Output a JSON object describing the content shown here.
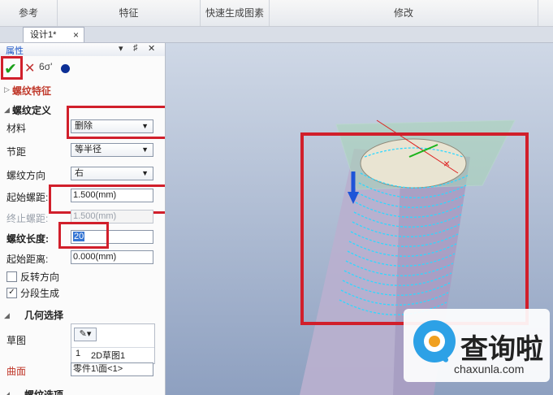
{
  "ribbon": {
    "groups": [
      "参考",
      "特征",
      "快速生成图素",
      "修改"
    ]
  },
  "document_tab": {
    "title": "设计1*"
  },
  "panel": {
    "title": "属性",
    "header_controls": [
      "▾",
      "♯",
      "✕"
    ],
    "toolbar": {
      "ok": "✔",
      "cancel": "✕",
      "preview": "6σ'"
    },
    "section_feature": "螺纹特征",
    "section_definition": "螺纹定义",
    "material": {
      "label": "材料",
      "value": "删除"
    },
    "pitch": {
      "label": "节距",
      "value": "等半径"
    },
    "direction": {
      "label": "螺纹方向",
      "value": "右"
    },
    "start_pitch": {
      "label": "起始螺距:",
      "value": "1.500(mm)"
    },
    "end_pitch": {
      "label": "终止螺距:",
      "value": "1.500(mm)"
    },
    "thread_length": {
      "label": "螺纹长度:",
      "value": "20"
    },
    "start_distance": {
      "label": "起始距离:",
      "value": "0.000(mm)"
    },
    "reverse": {
      "label": "反转方向",
      "checked": false
    },
    "segmented": {
      "label": "分段生成",
      "checked": true
    },
    "section_geometry": "几何选择",
    "sketch": {
      "label": "草图",
      "row_index": "1",
      "row_value": "2D草图1"
    },
    "surface": {
      "label": "曲面",
      "value": "零件1\\面<1>"
    },
    "section_options": "螺纹选项"
  },
  "watermark": {
    "cn": "查询啦",
    "url": "chaxunla.com"
  }
}
